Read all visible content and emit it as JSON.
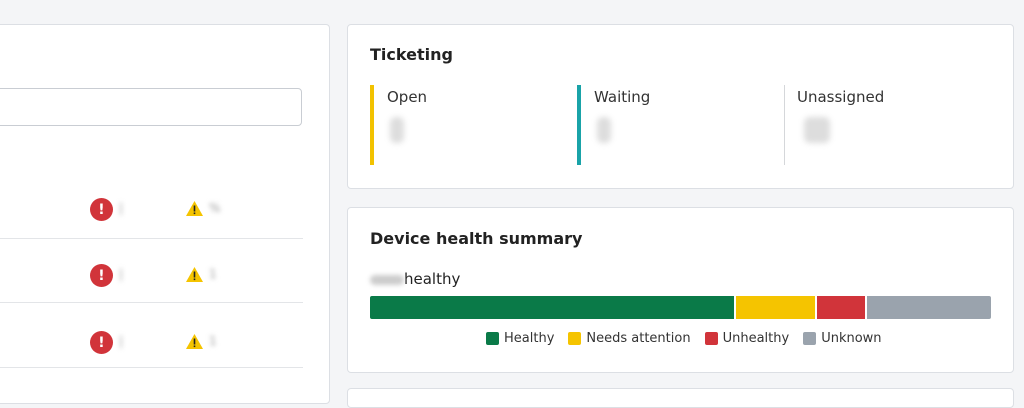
{
  "ticketing": {
    "title": "Ticketing",
    "stats": [
      {
        "label": "Open",
        "color": "#f2c200"
      },
      {
        "label": "Waiting",
        "color": "#19a3a8"
      },
      {
        "label": "Unassigned",
        "color": "#d5d7da"
      }
    ]
  },
  "device_health": {
    "title": "Device health summary",
    "subtitle_suffix": "healthy",
    "segments": [
      {
        "name": "Healthy",
        "color": "#0a7a48",
        "fraction": 0.59
      },
      {
        "name": "Needs attention",
        "color": "#f5c400",
        "fraction": 0.13
      },
      {
        "name": "Unhealthy",
        "color": "#d1343a",
        "fraction": 0.08
      },
      {
        "name": "Unknown",
        "color": "#9aa3ad",
        "fraction": 0.2
      }
    ]
  },
  "left_panel": {
    "rows": [
      {
        "error_icon": "exclamation-circle-icon",
        "warning_icon": "warning-triangle-icon"
      },
      {
        "error_icon": "exclamation-circle-icon",
        "warning_icon": "warning-triangle-icon"
      },
      {
        "error_icon": "exclamation-circle-icon",
        "warning_icon": "warning-triangle-icon"
      }
    ]
  }
}
